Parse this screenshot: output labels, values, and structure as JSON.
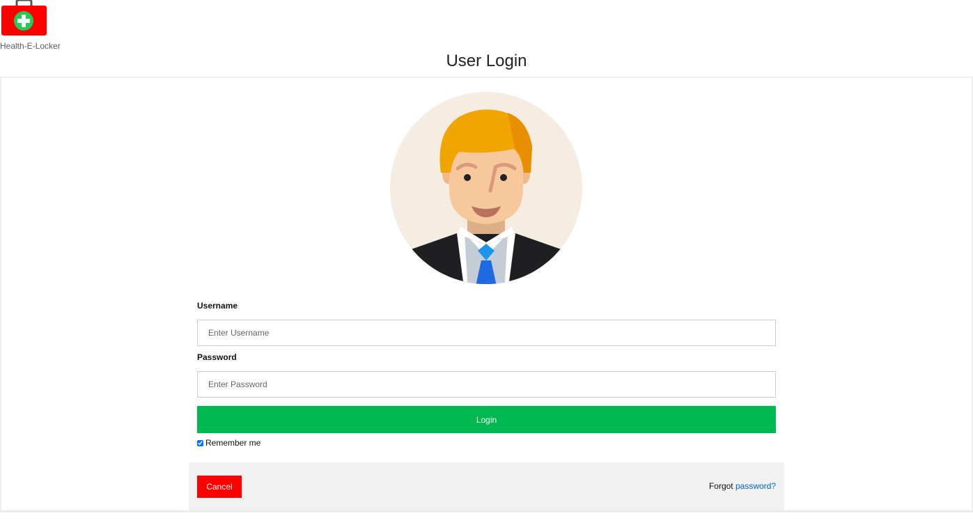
{
  "brand": {
    "name": "Health-E-Locker",
    "icon": "first-aid-kit-icon",
    "colors": {
      "case": "#ff0000",
      "cross_circle": "#22cc55"
    }
  },
  "page": {
    "title": "User Login"
  },
  "form": {
    "avatar_icon": "user-avatar-icon",
    "username": {
      "label": "Username",
      "placeholder": "Enter Username",
      "value": ""
    },
    "password": {
      "label": "Password",
      "placeholder": "Enter Password",
      "value": ""
    },
    "login_label": "Login",
    "remember": {
      "label": "Remember me",
      "checked": true
    }
  },
  "footer": {
    "cancel_label": "Cancel",
    "forgot_prefix": "Forgot ",
    "forgot_link": "password?"
  },
  "colors": {
    "login_button": "#00b851",
    "cancel_button": "#ff0000",
    "link": "#0066cc",
    "footer_bg": "#f1f1f1"
  }
}
